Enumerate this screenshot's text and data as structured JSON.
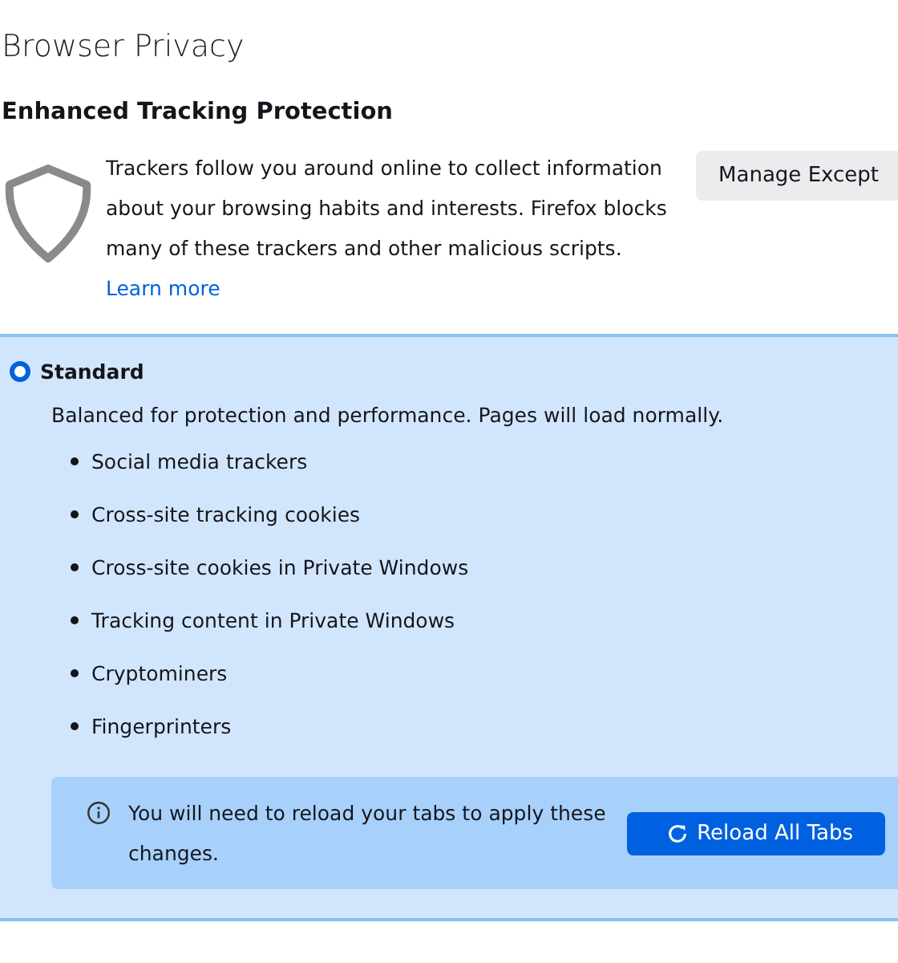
{
  "page_title": "Browser Privacy",
  "section_title": "Enhanced Tracking Protection",
  "intro": {
    "text": "Trackers follow you around online to collect information about your browsing habits and interests. Firefox blocks many of these trackers and other malicious scripts.",
    "link": "Learn more",
    "button": "Manage Except"
  },
  "options": [
    {
      "label": "Standard",
      "selected": true,
      "description": "Balanced for protection and performance. Pages will load normally.",
      "items": [
        "Social media trackers",
        "Cross-site tracking cookies",
        "Cross-site cookies in Private Windows",
        "Tracking content in Private Windows",
        "Cryptominers",
        "Fingerprinters"
      ],
      "notice": {
        "text": "You will need to reload your tabs to apply these changes.",
        "button": "Reload All Tabs"
      }
    }
  ]
}
